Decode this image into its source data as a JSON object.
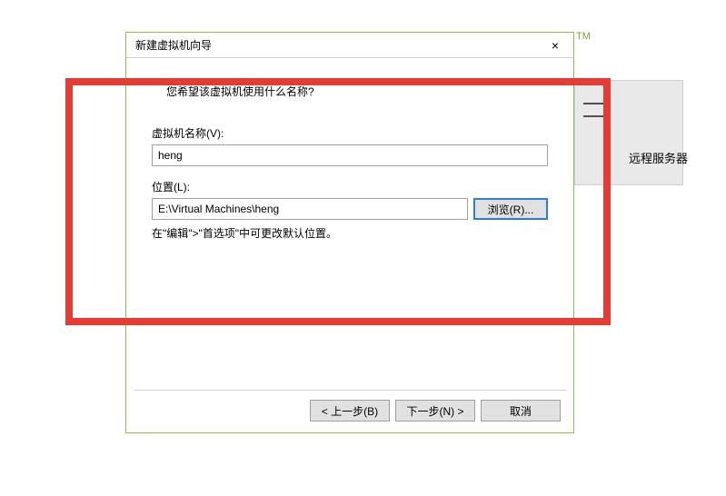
{
  "tm_mark": "TM",
  "background": {
    "remote_server_label": "远程服务器"
  },
  "dialog": {
    "title": "新建虚拟机向导",
    "close_symbol": "×",
    "subtitle": "您希望该虚拟机使用什么名称?",
    "vm_name": {
      "label": "虚拟机名称(V):",
      "value": "heng"
    },
    "location": {
      "label": "位置(L):",
      "value": "E:\\Virtual Machines\\heng",
      "browse_label": "浏览(R)..."
    },
    "hint": "在\"编辑\">\"首选项\"中可更改默认位置。",
    "footer": {
      "back": "< 上一步(B)",
      "next": "下一步(N) >",
      "cancel": "取消"
    }
  }
}
